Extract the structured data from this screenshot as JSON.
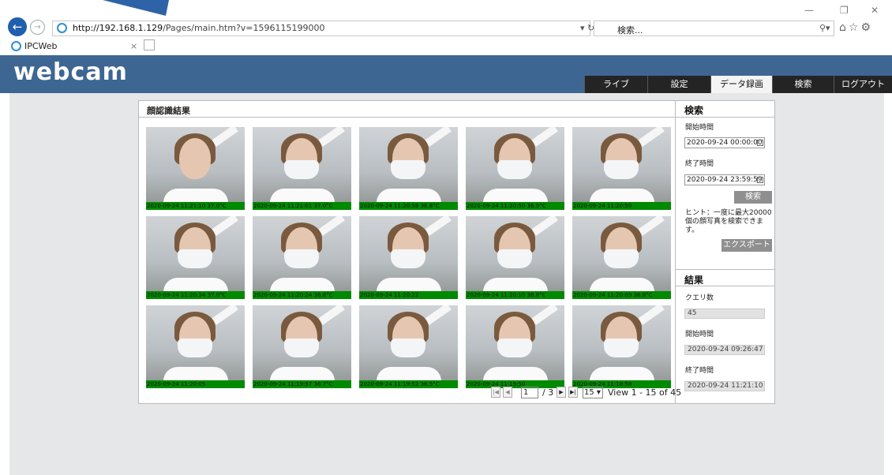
{
  "browser": {
    "url_host": "http://192.168.1.129",
    "url_path": "/Pages/main.htm?v=1596115199000",
    "search_placeholder": "検索...",
    "tab_title": "IPCWeb"
  },
  "app": {
    "logo": "webcam",
    "nav": [
      {
        "label": "ライブ"
      },
      {
        "label": "設定"
      },
      {
        "label": "データ録画"
      },
      {
        "label": "検索"
      },
      {
        "label": "ログアウト"
      }
    ],
    "active_nav": "データ録画"
  },
  "results": {
    "title": "顔認識結果",
    "captures": [
      {
        "caption": "2020-09-24 11:21:10 37.0°C",
        "masked": false
      },
      {
        "caption": "2020-09-24 11:21:01 37.0°C",
        "masked": true
      },
      {
        "caption": "2020-09-24 11:20:58 36.8°C",
        "masked": true
      },
      {
        "caption": "2020-09-24 11:20:50 36.9°C",
        "masked": true
      },
      {
        "caption": "2020-09-24 11:20:50",
        "masked": true
      },
      {
        "caption": "2020-09-24 11:20:34 37.0°C",
        "masked": true
      },
      {
        "caption": "2020-09-24 11:20:24 36.8°C",
        "masked": true
      },
      {
        "caption": "2020-09-24 11:20:22",
        "masked": true
      },
      {
        "caption": "2020-09-24 11:20:10 36.8°C",
        "masked": true
      },
      {
        "caption": "2020-09-24 11:20:09 36.8°C",
        "masked": true
      },
      {
        "caption": "2020-09-24 11:20:05",
        "masked": true
      },
      {
        "caption": "2020-09-24 11:19:57 36.7°C",
        "masked": true
      },
      {
        "caption": "2020-09-24 11:19:52 36.5°C",
        "masked": true
      },
      {
        "caption": "2020-09-24 11:19:50",
        "masked": true
      },
      {
        "caption": "2020-09-24 11:18:58",
        "masked": true
      }
    ]
  },
  "pagination": {
    "page": "1",
    "total": "/ 3",
    "rows": "15",
    "view": "View 1 - 15 of 45"
  },
  "search": {
    "title": "検索",
    "start_label": "開始時間",
    "start_value": "2020-09-24 00:00:00",
    "end_label": "終了時間",
    "end_value": "2020-09-24 23:59:59",
    "search_button": "検索",
    "hint": "ヒント：一度に最大20000個の顔写真を検索できます。",
    "export_button": "エクスポート"
  },
  "summary": {
    "title": "結果",
    "count_label": "クエリ数",
    "count_value": "45",
    "start_label": "開始時間",
    "start_value": "2020-09-24 09:26:47",
    "end_label": "終了時間",
    "end_value": "2020-09-24 11:21:10"
  },
  "colors": {
    "header_bg": "#3e6692",
    "caption_bg": "#008a00",
    "nav_bg": "#242424"
  }
}
